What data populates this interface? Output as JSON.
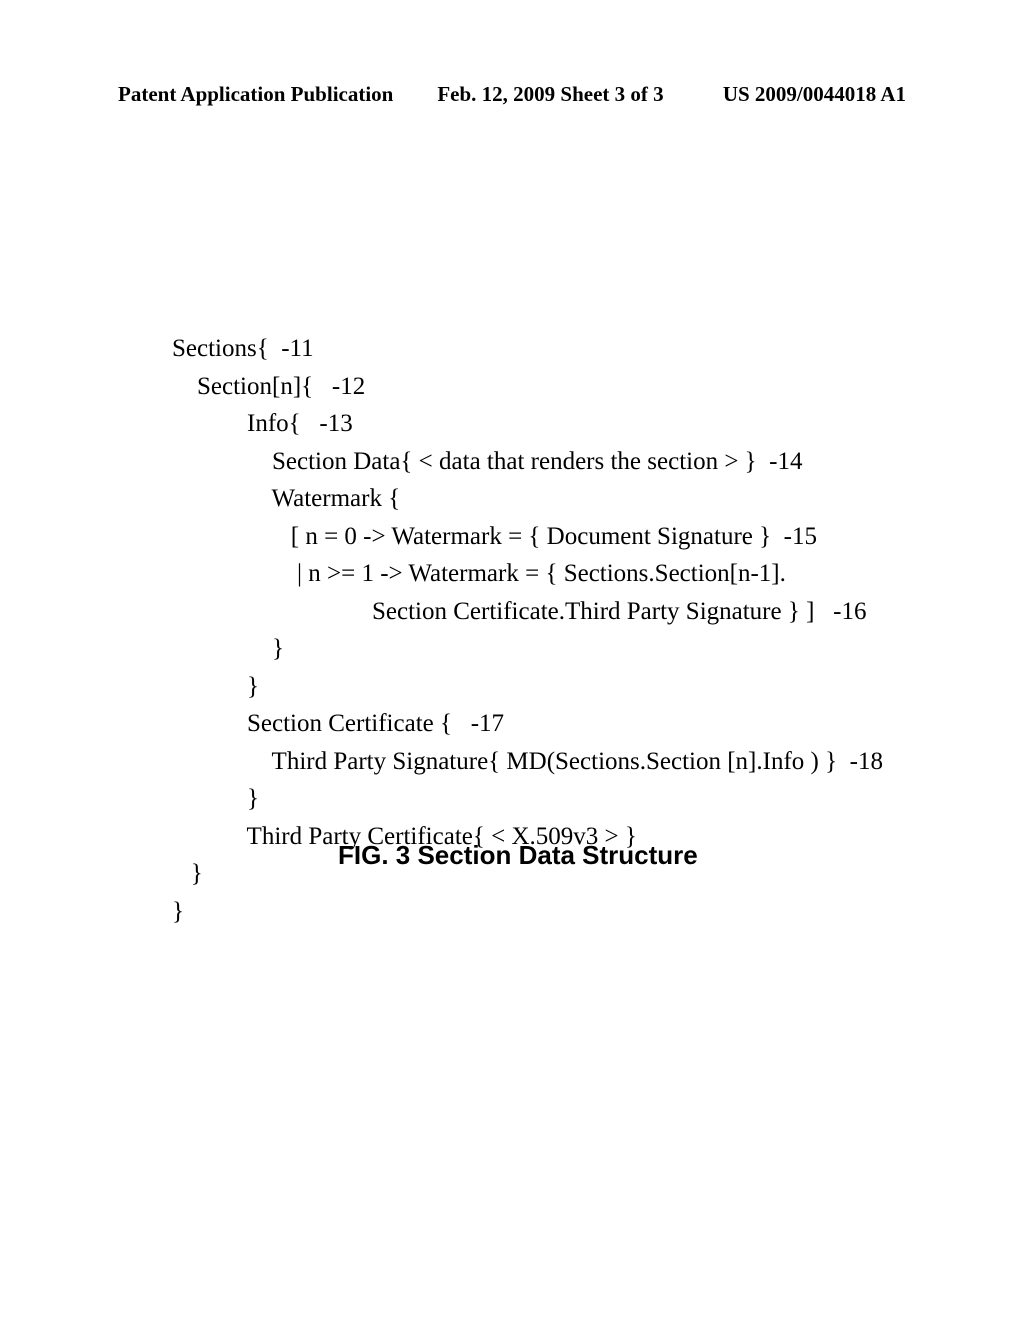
{
  "header": {
    "left": "Patent Application Publication",
    "center": "Feb. 12, 2009  Sheet 3 of 3",
    "right": "US 2009/0044018 A1"
  },
  "code": {
    "l01": "Sections{  -11",
    "l02": "    Section[n]{   -12",
    "l03": "            Info{   -13",
    "l04": "                Section Data{ < data that renders the section > }  -14",
    "l05": "                Watermark {",
    "l06": "                   [ n = 0 -> Watermark = { Document Signature }  -15",
    "l07": "                    | n >= 1 -> Watermark = { Sections.Section[n-1].",
    "l08": "                                Section Certificate.Third Party Signature } ]   -16",
    "l09": "                }",
    "l10": "            }",
    "l11": "            Section Certificate {   -17",
    "l12": "                Third Party Signature{ MD(Sections.Section [n].Info ) }  -18",
    "l13": "            }",
    "l14": "            Third Party Certificate{ < X.509v3 > }",
    "l15": "   }",
    "l16": "}"
  },
  "caption": "FIG. 3 Section Data Structure"
}
